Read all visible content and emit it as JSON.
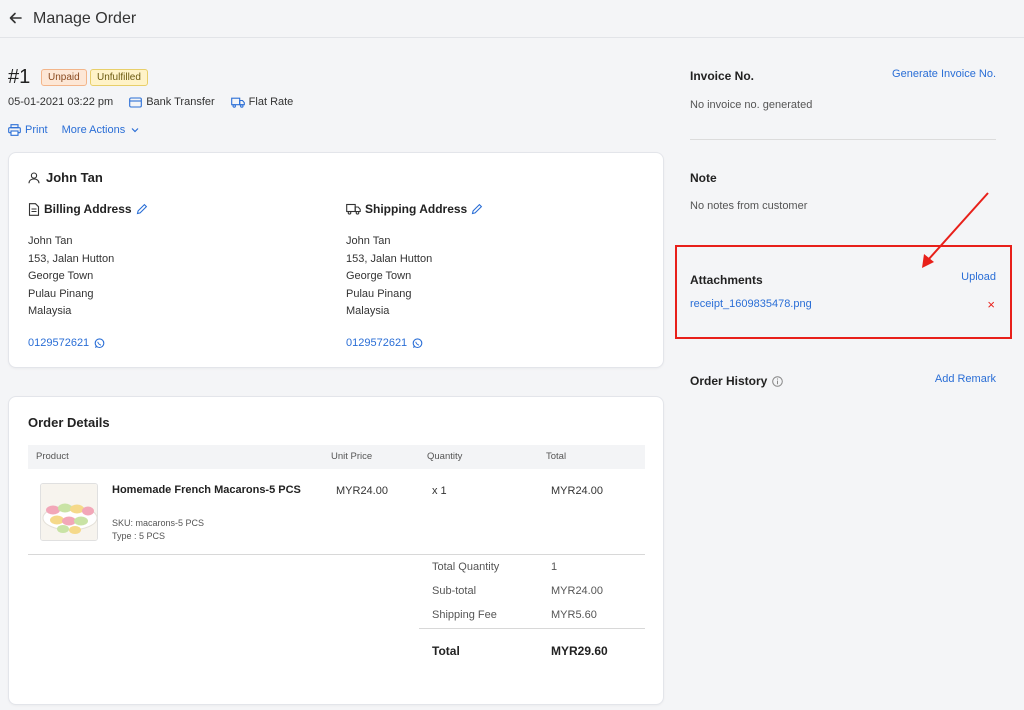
{
  "header": {
    "title": "Manage Order"
  },
  "order": {
    "number": "#1",
    "badges": {
      "payment": "Unpaid",
      "fulfillment": "Unfulfilled"
    },
    "datetime": "05-01-2021 03:22 pm",
    "payment_method": "Bank Transfer",
    "shipping_method": "Flat Rate",
    "print_label": "Print",
    "more_actions_label": "More Actions"
  },
  "customer": {
    "name": "John Tan",
    "billing": {
      "title": "Billing Address",
      "lines": [
        "John Tan",
        "153, Jalan Hutton",
        "George Town",
        "Pulau Pinang",
        "Malaysia"
      ],
      "phone": "0129572621"
    },
    "shipping": {
      "title": "Shipping Address",
      "lines": [
        "John Tan",
        "153, Jalan Hutton",
        "George Town",
        "Pulau Pinang",
        "Malaysia"
      ],
      "phone": "0129572621"
    }
  },
  "order_details": {
    "title": "Order Details",
    "columns": {
      "product": "Product",
      "unit_price": "Unit Price",
      "quantity": "Quantity",
      "total": "Total"
    },
    "item": {
      "name": "Homemade French Macarons-5 PCS",
      "sku": "SKU: macarons-5 PCS",
      "type": "Type : 5 PCS",
      "unit_price": "MYR24.00",
      "quantity": "x 1",
      "total": "MYR24.00"
    },
    "summary": {
      "total_quantity_label": "Total Quantity",
      "total_quantity": "1",
      "subtotal_label": "Sub-total",
      "subtotal": "MYR24.00",
      "shipping_label": "Shipping Fee",
      "shipping": "MYR5.60",
      "total_label": "Total",
      "total": "MYR29.60"
    }
  },
  "sidebar": {
    "invoice": {
      "title": "Invoice No.",
      "action": "Generate Invoice No.",
      "text": "No invoice no. generated"
    },
    "note": {
      "title": "Note",
      "text": "No notes from customer"
    },
    "attachments": {
      "title": "Attachments",
      "action": "Upload",
      "file": "receipt_1609835478.png",
      "remove": "×"
    },
    "history": {
      "title": "Order History",
      "action": "Add Remark"
    }
  },
  "colors": {
    "link": "#2a6ed6",
    "annotation": "#e8201a"
  }
}
